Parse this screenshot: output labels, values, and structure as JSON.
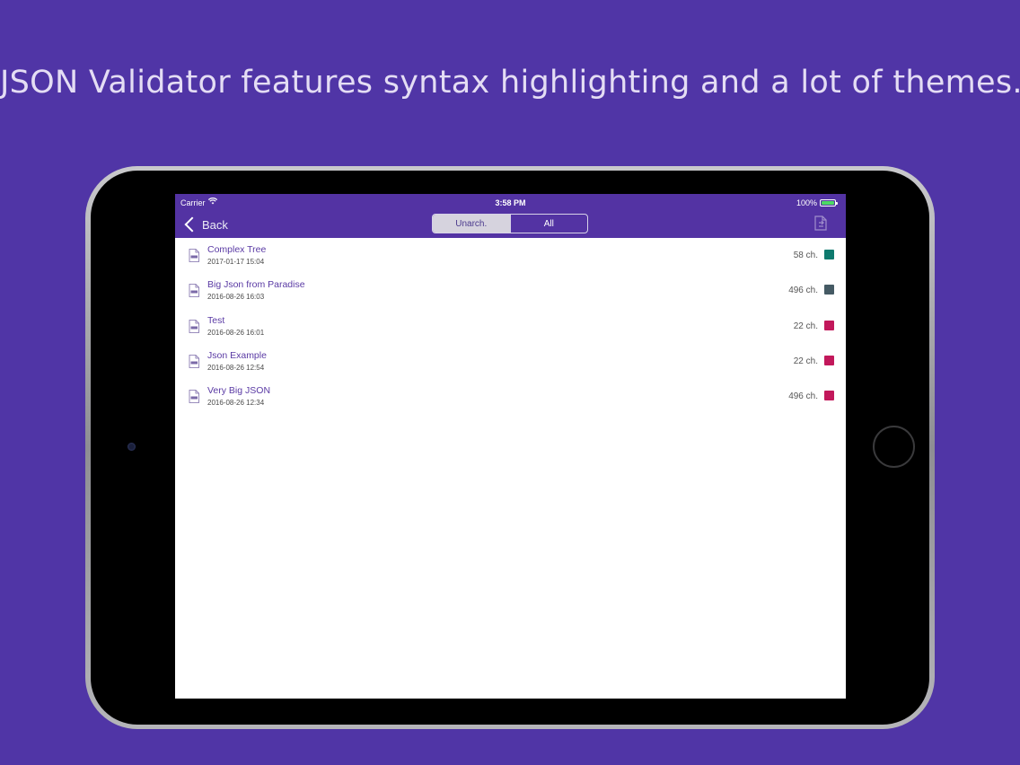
{
  "headline": "JSON Validator features syntax highlighting and a lot of themes.",
  "status_bar": {
    "carrier": "Carrier",
    "time": "3:58 PM",
    "battery": "100%"
  },
  "nav": {
    "back_label": "Back",
    "segments": [
      {
        "label": "Unarch.",
        "selected": true
      },
      {
        "label": "All",
        "selected": false
      }
    ]
  },
  "files": [
    {
      "title": "Complex Tree",
      "date": "2017-01-17 15:04",
      "size": "58 ch.",
      "color": "#0e7a6e"
    },
    {
      "title": "Big Json from Paradise",
      "date": "2016-08-26 16:03",
      "size": "496 ch.",
      "color": "#455a64"
    },
    {
      "title": "Test",
      "date": "2016-08-26 16:01",
      "size": "22 ch.",
      "color": "#c2185b"
    },
    {
      "title": "Json Example",
      "date": "2016-08-26 12:54",
      "size": "22 ch.",
      "color": "#c2185b"
    },
    {
      "title": "Very Big JSON",
      "date": "2016-08-26 12:34",
      "size": "496 ch.",
      "color": "#c2185b"
    }
  ],
  "colors": {
    "background": "#5035a6",
    "bar": "#5333a3",
    "accent": "#5a3aa4"
  }
}
